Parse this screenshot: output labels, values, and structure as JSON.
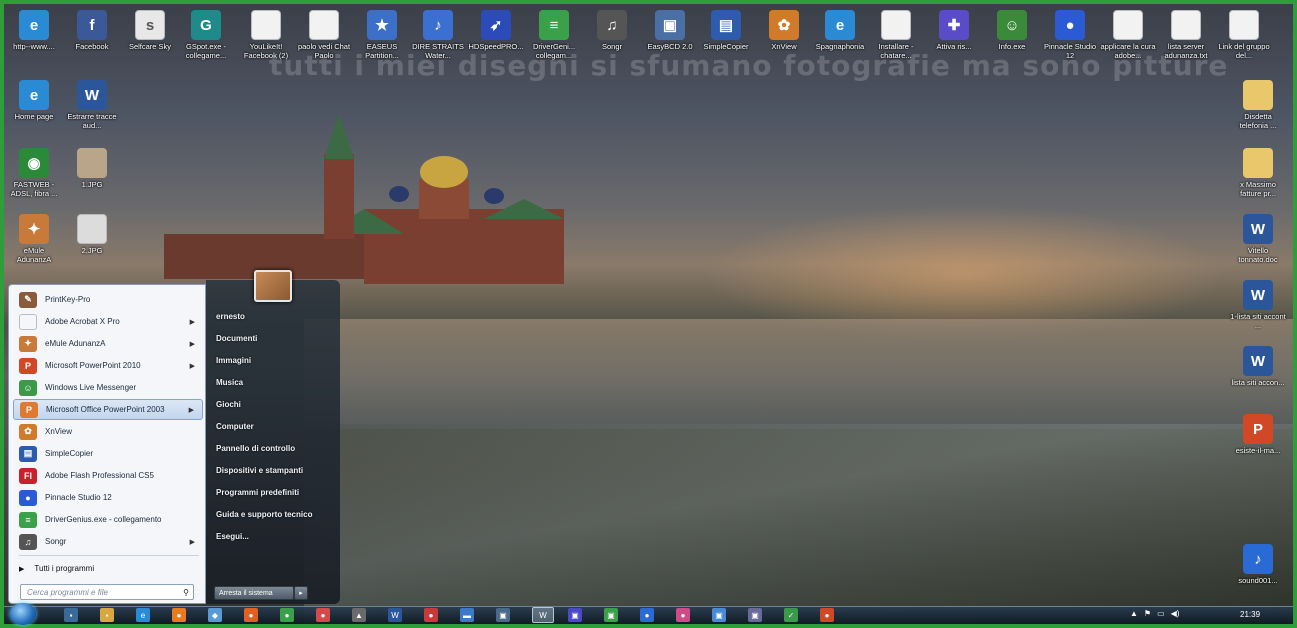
{
  "watermark": "tutti i miei disegni si sfumano fotografie ma sono pitture",
  "desktop_top": [
    {
      "label": "http--www....",
      "icon": "ie-icon",
      "color": "#2a8ad4",
      "glyph": "e"
    },
    {
      "label": "Facebook",
      "icon": "facebook-icon",
      "color": "#3b5998",
      "glyph": "f"
    },
    {
      "label": "Selfcare Sky",
      "icon": "sky-icon",
      "color": "#e8e8e8",
      "glyph": "s"
    },
    {
      "label": "GSpot.exe - collegame...",
      "icon": "gspot-icon",
      "color": "#1e8a8a",
      "glyph": "G"
    },
    {
      "label": "YouLikeIt! Facebook (2)",
      "icon": "document-icon",
      "color": "#f2f2f2",
      "glyph": ""
    },
    {
      "label": "paolo vedi Chat Paolo",
      "icon": "document-icon",
      "color": "#f2f2f2",
      "glyph": ""
    },
    {
      "label": "EASEUS Partition...",
      "icon": "easeus-icon",
      "color": "#3c6fc8",
      "glyph": "★"
    },
    {
      "label": "DIRE STRAITS Water...",
      "icon": "mp3-icon",
      "color": "#3b6fd1",
      "glyph": "♪"
    },
    {
      "label": "HDSpeedPRO...",
      "icon": "rocket-icon",
      "color": "#2a4bb8",
      "glyph": "➶"
    },
    {
      "label": "DriverGeni... collegam...",
      "icon": "drivergenius-icon",
      "color": "#3aa04a",
      "glyph": "≡"
    },
    {
      "label": "Songr",
      "icon": "music-icon",
      "color": "#555",
      "glyph": "♫"
    },
    {
      "label": "EasyBCD 2.0",
      "icon": "easybcd-icon",
      "color": "#4a6fa5",
      "glyph": "▣"
    },
    {
      "label": "SimpleCopier",
      "icon": "simplecopier-icon",
      "color": "#2d5cae",
      "glyph": "▤"
    },
    {
      "label": "XnView",
      "icon": "xnview-icon",
      "color": "#d07a2a",
      "glyph": "✿"
    },
    {
      "label": "Spagnaphonia",
      "icon": "ie-icon",
      "color": "#2a8ad4",
      "glyph": "e"
    },
    {
      "label": "Installare - chatare...",
      "icon": "document-icon",
      "color": "#f2f2f2",
      "glyph": ""
    },
    {
      "label": "Attiva ris...",
      "icon": "puzzle-icon",
      "color": "#5a4bc8",
      "glyph": "✚"
    },
    {
      "label": "Info.exe",
      "icon": "messenger-icon",
      "color": "#3a8a3a",
      "glyph": "☺"
    },
    {
      "label": "Pinnacle Studio 12",
      "icon": "pinnacle-icon",
      "color": "#2a5ad4",
      "glyph": "●"
    },
    {
      "label": "applicare la cura adobe...",
      "icon": "document-icon",
      "color": "#f2f2f2",
      "glyph": ""
    },
    {
      "label": "lista server adunanza.txt",
      "icon": "document-icon",
      "color": "#f2f2f2",
      "glyph": ""
    },
    {
      "label": "Link del gruppo del...",
      "icon": "document-icon",
      "color": "#f2f2f2",
      "glyph": ""
    }
  ],
  "desktop_left": [
    {
      "label": "Home page",
      "icon": "ie-icon",
      "color": "#2a8ad4",
      "glyph": "e"
    },
    {
      "label": "Estrarre tracce aud...",
      "icon": "word-icon",
      "color": "#2b579a",
      "glyph": "W"
    },
    {
      "label": "FASTWEB - ADSL, fibra ...",
      "icon": "globe-icon",
      "color": "#2a8a3a",
      "glyph": "◉"
    },
    {
      "label": "1.JPG",
      "icon": "image-icon",
      "color": "#b8a58a",
      "glyph": ""
    },
    {
      "label": "eMule AdunanzA",
      "icon": "emule-icon",
      "color": "#c87a3a",
      "glyph": "✦"
    },
    {
      "label": "2.JPG",
      "icon": "image-icon",
      "color": "#dcdcdc",
      "glyph": ""
    }
  ],
  "desktop_right": [
    {
      "label": "Disdetta telefonia ...",
      "icon": "folder-icon",
      "color": "#e8c86a",
      "glyph": ""
    },
    {
      "label": "x Massimo fatture pr...",
      "icon": "folder-icon",
      "color": "#e8c86a",
      "glyph": ""
    },
    {
      "label": "Vitello tonnato.doc",
      "icon": "word-icon",
      "color": "#2b579a",
      "glyph": "W"
    },
    {
      "label": "1-lista siti accont ...",
      "icon": "word-icon",
      "color": "#2b579a",
      "glyph": "W"
    },
    {
      "label": "lista siti accon...",
      "icon": "word-icon",
      "color": "#2b579a",
      "glyph": "W"
    },
    {
      "label": "esiste-il-ma...",
      "icon": "powerpoint-icon",
      "color": "#d24726",
      "glyph": "P"
    },
    {
      "label": "sound001...",
      "icon": "wav-icon",
      "color": "#2a6ad4",
      "glyph": "♪"
    }
  ],
  "start_menu": {
    "programs": [
      {
        "label": "PrintKey-Pro",
        "icon": "printkey-icon",
        "color": "#8a5a3a",
        "glyph": "✎",
        "arrow": false,
        "selected": false
      },
      {
        "label": "Adobe Acrobat X Pro",
        "icon": "acrobat-icon",
        "color": "#f4f6f9",
        "glyph": "",
        "arrow": true,
        "selected": false
      },
      {
        "label": "eMule AdunanzA",
        "icon": "emule-icon",
        "color": "#c87a3a",
        "glyph": "✦",
        "arrow": true,
        "selected": false
      },
      {
        "label": "Microsoft PowerPoint 2010",
        "icon": "powerpoint-icon",
        "color": "#d24726",
        "glyph": "P",
        "arrow": true,
        "selected": false
      },
      {
        "label": "Windows Live Messenger",
        "icon": "messenger-icon",
        "color": "#3a9a4a",
        "glyph": "☺",
        "arrow": false,
        "selected": false
      },
      {
        "label": "Microsoft Office PowerPoint 2003",
        "icon": "powerpoint2003-icon",
        "color": "#e07a30",
        "glyph": "P",
        "arrow": true,
        "selected": true
      },
      {
        "label": "XnView",
        "icon": "xnview-icon",
        "color": "#d07a2a",
        "glyph": "✿",
        "arrow": false,
        "selected": false
      },
      {
        "label": "SimpleCopier",
        "icon": "simplecopier-icon",
        "color": "#2d5cae",
        "glyph": "▤",
        "arrow": false,
        "selected": false
      },
      {
        "label": "Adobe Flash Professional CS5",
        "icon": "flash-icon",
        "color": "#c8202a",
        "glyph": "Fl",
        "arrow": false,
        "selected": false
      },
      {
        "label": "Pinnacle Studio 12",
        "icon": "pinnacle-icon",
        "color": "#2a5ad4",
        "glyph": "●",
        "arrow": false,
        "selected": false
      },
      {
        "label": "DriverGenius.exe - collegamento",
        "icon": "drivergenius-icon",
        "color": "#3aa04a",
        "glyph": "≡",
        "arrow": false,
        "selected": false
      },
      {
        "label": "Songr",
        "icon": "music-icon",
        "color": "#555",
        "glyph": "♫",
        "arrow": true,
        "selected": false
      }
    ],
    "all_programs": "Tutti i programmi",
    "search_placeholder": "Cerca programmi e file",
    "right_items": [
      "ernesto",
      "Documenti",
      "Immagini",
      "Musica",
      "Giochi",
      "Computer",
      "Pannello di controllo",
      "Dispositivi e stampanti",
      "Programmi predefiniti",
      "Guida e supporto tecnico",
      "Esegui..."
    ],
    "shutdown": "Arresta il sistema"
  },
  "taskbar": {
    "apps": [
      {
        "icon": "windows-icon",
        "color": "#3a6a9a",
        "glyph": "▪"
      },
      {
        "icon": "explorer-icon",
        "color": "#d8a840",
        "glyph": "▪"
      },
      {
        "icon": "ie-icon",
        "color": "#2a8ad4",
        "glyph": "e"
      },
      {
        "icon": "media-icon",
        "color": "#e87a20",
        "glyph": "●"
      },
      {
        "icon": "network-icon",
        "color": "#5a9ad4",
        "glyph": "◆"
      },
      {
        "icon": "firefox-icon",
        "color": "#e06020",
        "glyph": "●"
      },
      {
        "icon": "app-icon",
        "color": "#3aa04a",
        "glyph": "●"
      },
      {
        "icon": "app-icon",
        "color": "#d44a4a",
        "glyph": "●"
      },
      {
        "icon": "chart-icon",
        "color": "#6a6a6a",
        "glyph": "▲"
      },
      {
        "icon": "word-icon",
        "color": "#2b579a",
        "glyph": "W"
      },
      {
        "icon": "app-icon",
        "color": "#c83a3a",
        "glyph": "●"
      },
      {
        "icon": "monitor-icon",
        "color": "#3a7ac8",
        "glyph": "▬"
      },
      {
        "icon": "photo-icon",
        "color": "#4a6a8a",
        "glyph": "▣"
      },
      {
        "icon": "word-icon",
        "color": "#2b579a",
        "glyph": "W"
      },
      {
        "icon": "app-icon",
        "color": "#4a4ac8",
        "glyph": "▣"
      },
      {
        "icon": "app-icon",
        "color": "#3aa04a",
        "glyph": "▣"
      },
      {
        "icon": "app-icon",
        "color": "#2a6ad4",
        "glyph": "●"
      },
      {
        "icon": "app-icon",
        "color": "#d04a8a",
        "glyph": "●"
      },
      {
        "icon": "app-icon",
        "color": "#4a8ad4",
        "glyph": "▣"
      },
      {
        "icon": "app-icon",
        "color": "#6a6a9a",
        "glyph": "▣"
      },
      {
        "icon": "app-icon",
        "color": "#3a9a4a",
        "glyph": "✓"
      },
      {
        "icon": "powerpoint-icon",
        "color": "#d24726",
        "glyph": "●"
      }
    ],
    "clock": "21:39"
  }
}
